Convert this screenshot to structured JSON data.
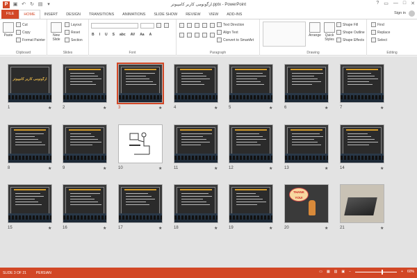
{
  "window": {
    "title": "ارگونومی کاربر کامپیوتر.pptx - PowerPoint",
    "app_icon": "P",
    "controls": [
      "?",
      "▭",
      "—",
      "□",
      "✕"
    ]
  },
  "tabs": [
    "FILE",
    "HOME",
    "INSERT",
    "DESIGN",
    "TRANSITIONS",
    "ANIMATIONS",
    "SLIDE SHOW",
    "REVIEW",
    "VIEW",
    "ADD-INS"
  ],
  "active_tab": "HOME",
  "signin": "Sign in",
  "ribbon": {
    "clipboard": {
      "paste": "Paste",
      "cut": "Cut",
      "copy": "Copy",
      "format_painter": "Format Painter",
      "label": "Clipboard"
    },
    "slides": {
      "new_slide": "New Slide",
      "layout": "Layout",
      "reset": "Reset",
      "section": "Section",
      "label": "Slides"
    },
    "font": {
      "label": "Font",
      "buttons": [
        "B",
        "I",
        "U",
        "S",
        "abc",
        "AV",
        "Aa",
        "A"
      ]
    },
    "paragraph": {
      "text_direction": "Text Direction",
      "align_text": "Align Text",
      "convert_smartart": "Convert to SmartArt",
      "label": "Paragraph"
    },
    "drawing": {
      "arrange": "Arrange",
      "quick_styles": "Quick Styles",
      "shape_fill": "Shape Fill",
      "shape_outline": "Shape Outline",
      "shape_effects": "Shape Effects",
      "label": "Drawing"
    },
    "editing": {
      "find": "Find",
      "replace": "Replace",
      "select": "Select",
      "label": "Editing"
    }
  },
  "slides": [
    {
      "number": "1",
      "kind": "title",
      "title": "ارگونومی کاربر کامپیوتر",
      "star": "★"
    },
    {
      "number": "2",
      "kind": "text",
      "star": "★"
    },
    {
      "number": "3",
      "kind": "text",
      "star": "★",
      "selected": true
    },
    {
      "number": "4",
      "kind": "text",
      "star": "★"
    },
    {
      "number": "5",
      "kind": "text",
      "star": "★"
    },
    {
      "number": "6",
      "kind": "text",
      "star": "★"
    },
    {
      "number": "7",
      "kind": "text",
      "star": "★"
    },
    {
      "number": "8",
      "kind": "text",
      "star": "★"
    },
    {
      "number": "9",
      "kind": "text",
      "star": "★"
    },
    {
      "number": "10",
      "kind": "drawing",
      "star": "★"
    },
    {
      "number": "11",
      "kind": "text",
      "star": "★"
    },
    {
      "number": "12",
      "kind": "text",
      "star": "★"
    },
    {
      "number": "13",
      "kind": "text",
      "star": "★"
    },
    {
      "number": "14",
      "kind": "text",
      "star": "★"
    },
    {
      "number": "15",
      "kind": "text",
      "star": "★"
    },
    {
      "number": "16",
      "kind": "text",
      "star": "★"
    },
    {
      "number": "17",
      "kind": "text",
      "star": "★"
    },
    {
      "number": "18",
      "kind": "text",
      "star": "★"
    },
    {
      "number": "19",
      "kind": "text",
      "star": "★"
    },
    {
      "number": "20",
      "kind": "thankyou",
      "thank_text": "THANK YOU!",
      "star": "★"
    },
    {
      "number": "21",
      "kind": "photo",
      "star": "★"
    }
  ],
  "status": {
    "slide_info": "SLIDE 3 OF 21",
    "language": "PERSIAN",
    "zoom": "60%"
  },
  "colors": {
    "accent": "#d24726",
    "slide_bg": "#2b2b2b",
    "heading": "#d49b2a"
  }
}
